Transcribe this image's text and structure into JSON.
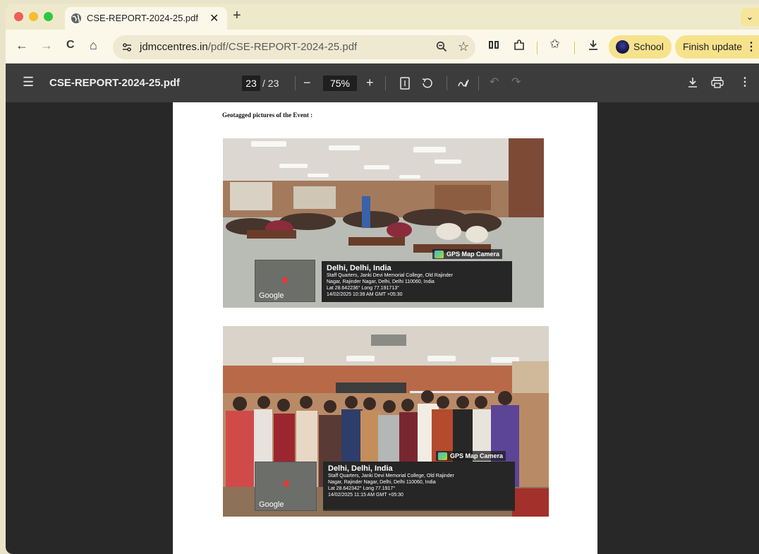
{
  "browser": {
    "tab": {
      "title": "CSE-REPORT-2024-25.pdf",
      "close_glyph": "✕"
    },
    "new_tab_glyph": "+",
    "tab_menu_glyph": "⌄",
    "nav": {
      "back": "←",
      "forward": "→",
      "reload": "C",
      "home": "⌂"
    },
    "url": {
      "host": "jdmccentres.in",
      "path": "/pdf/CSE-REPORT-2024-25.pdf"
    },
    "profile_label": "School",
    "update_label": "Finish update",
    "update_menu_glyph": "⋮",
    "colors": {
      "accent_yellow": "#f7e28c",
      "toolbar": "#fbf8ea"
    }
  },
  "pdf": {
    "title": "CSE-REPORT-2024-25.pdf",
    "current_page": "23",
    "page_total": "/ 23",
    "zoom": "75%",
    "zoom_out": "−",
    "zoom_in": "+",
    "caption": "Geotagged pictures of the Event :",
    "photos": [
      {
        "gps_label": "GPS Map Camera",
        "city": "Delhi, Delhi, India",
        "address1": "Staff Quarters, Janki Devi Memorial College, Old Rajinder",
        "address2": "Nagar, Rajinder Nagar, Delhi, Delhi 110060, India",
        "coords": "Lat 28.642236° Long 77.191713°",
        "timestamp": "14/02/2025 10:39 AM GMT +05:30",
        "map_brand": "Google"
      },
      {
        "gps_label": "GPS Map Camera",
        "city": "Delhi, Delhi, India",
        "address1": "Staff Quarters, Janki Devi Memorial College, Old Rajinder",
        "address2": "Nagar, Rajinder Nagar, Delhi, Delhi 110060, India",
        "coords": "Lat 28.642342° Long 77.1917°",
        "timestamp": "14/02/2025 11:15 AM GMT +05:30",
        "map_brand": "Google"
      }
    ]
  }
}
